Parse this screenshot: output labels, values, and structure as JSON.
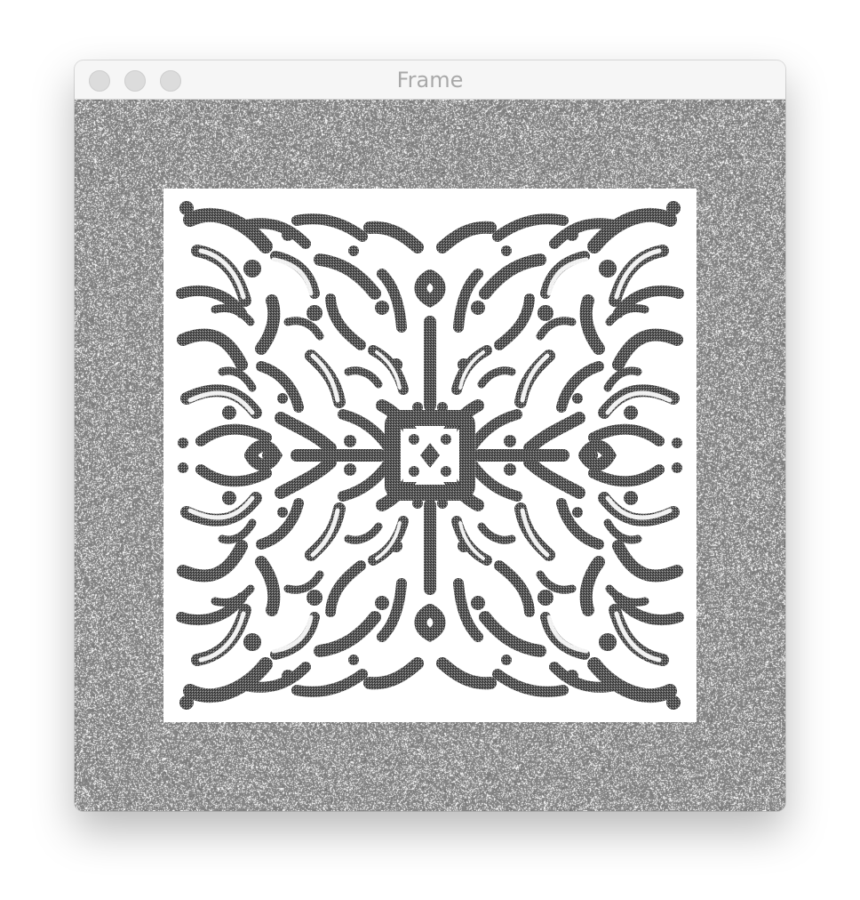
{
  "window": {
    "title": "Frame"
  },
  "title_bar": {
    "buttons": [
      {
        "name": "close",
        "color": "#dcdcdc"
      },
      {
        "name": "minimize",
        "color": "#dcdcdc"
      },
      {
        "name": "zoom",
        "color": "#dcdcdc"
      }
    ]
  },
  "image": {
    "description_colors": {
      "background_noise": "#858585",
      "pattern_background": "#ffffff",
      "pattern_strokes": "#5f5f5f"
    }
  }
}
